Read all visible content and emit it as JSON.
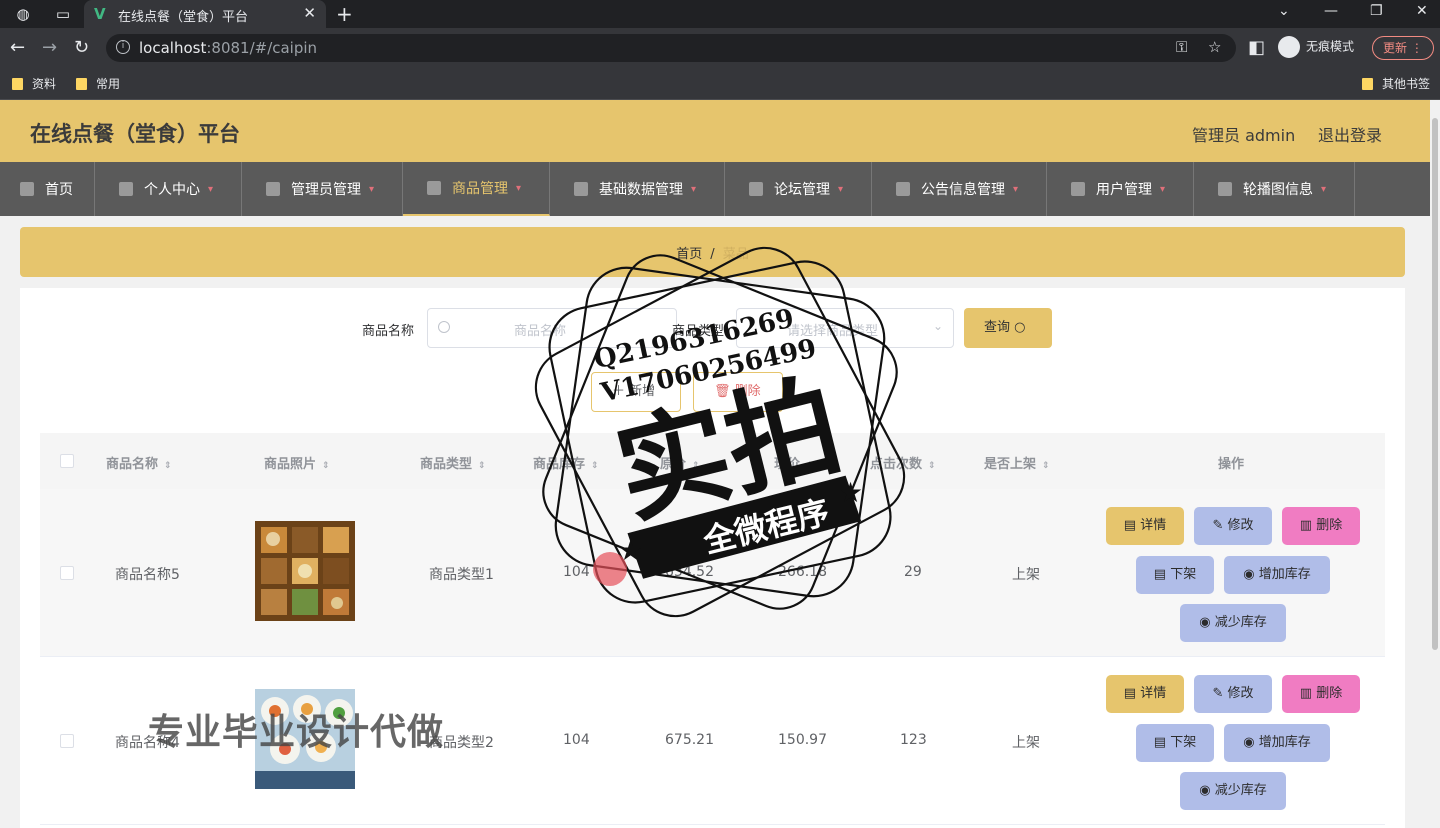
{
  "browser": {
    "tab_title": "在线点餐（堂食）平台",
    "url_host": "localhost",
    "url_rest": ":8081/#/caipin",
    "incognito_label": "无痕模式",
    "update_label": "更新",
    "bookmarks": [
      "资料",
      "常用"
    ],
    "other_bookmarks": "其他书签"
  },
  "header": {
    "title": "在线点餐（堂食）平台",
    "admin": "管理员 admin",
    "logout": "退出登录"
  },
  "nav": {
    "items": [
      {
        "label": "首页"
      },
      {
        "label": "个人中心"
      },
      {
        "label": "管理员管理"
      },
      {
        "label": "商品管理"
      },
      {
        "label": "基础数据管理"
      },
      {
        "label": "论坛管理"
      },
      {
        "label": "公告信息管理"
      },
      {
        "label": "用户管理"
      },
      {
        "label": "轮播图信息"
      }
    ],
    "active": "商品管理"
  },
  "breadcrumb": {
    "home": "首页",
    "sep": "/",
    "current": "菜品"
  },
  "search": {
    "name_label": "商品名称",
    "name_placeholder": "商品名称",
    "type_label": "商品类型",
    "type_placeholder": "请选择商品类型",
    "query_button": "查询"
  },
  "toolbar": {
    "add_button": "新增",
    "delete_button": "删除"
  },
  "table": {
    "columns": [
      "商品名称",
      "商品照片",
      "商品类型",
      "商品库存",
      "原价",
      "现价",
      "点击次数",
      "是否上架",
      "操作"
    ],
    "rows": [
      {
        "name": "商品名称5",
        "type": "商品类型1",
        "stock": "104",
        "price": "634.52",
        "current_price": "266.18",
        "clicks": "29",
        "shelf": "上架"
      },
      {
        "name": "商品名称4",
        "type": "商品类型2",
        "stock": "104",
        "price": "675.21",
        "current_price": "150.97",
        "clicks": "123",
        "shelf": "上架"
      }
    ],
    "actions": {
      "detail": "详情",
      "edit": "修改",
      "delete": "删除",
      "offshelf": "下架",
      "add_stock": "增加库存",
      "reduce_stock": "减少库存"
    }
  },
  "watermark": {
    "qq": "Q2196316269",
    "vx": "V17060256499",
    "big": "实拍",
    "ribbon": "全微程序",
    "bottom": "专业毕业设计代做"
  },
  "colors": {
    "accent": "#e6c56d",
    "nav_bg": "#5a5a5a",
    "btn_blue": "#b0bde8",
    "btn_pink": "#f07cc2"
  }
}
